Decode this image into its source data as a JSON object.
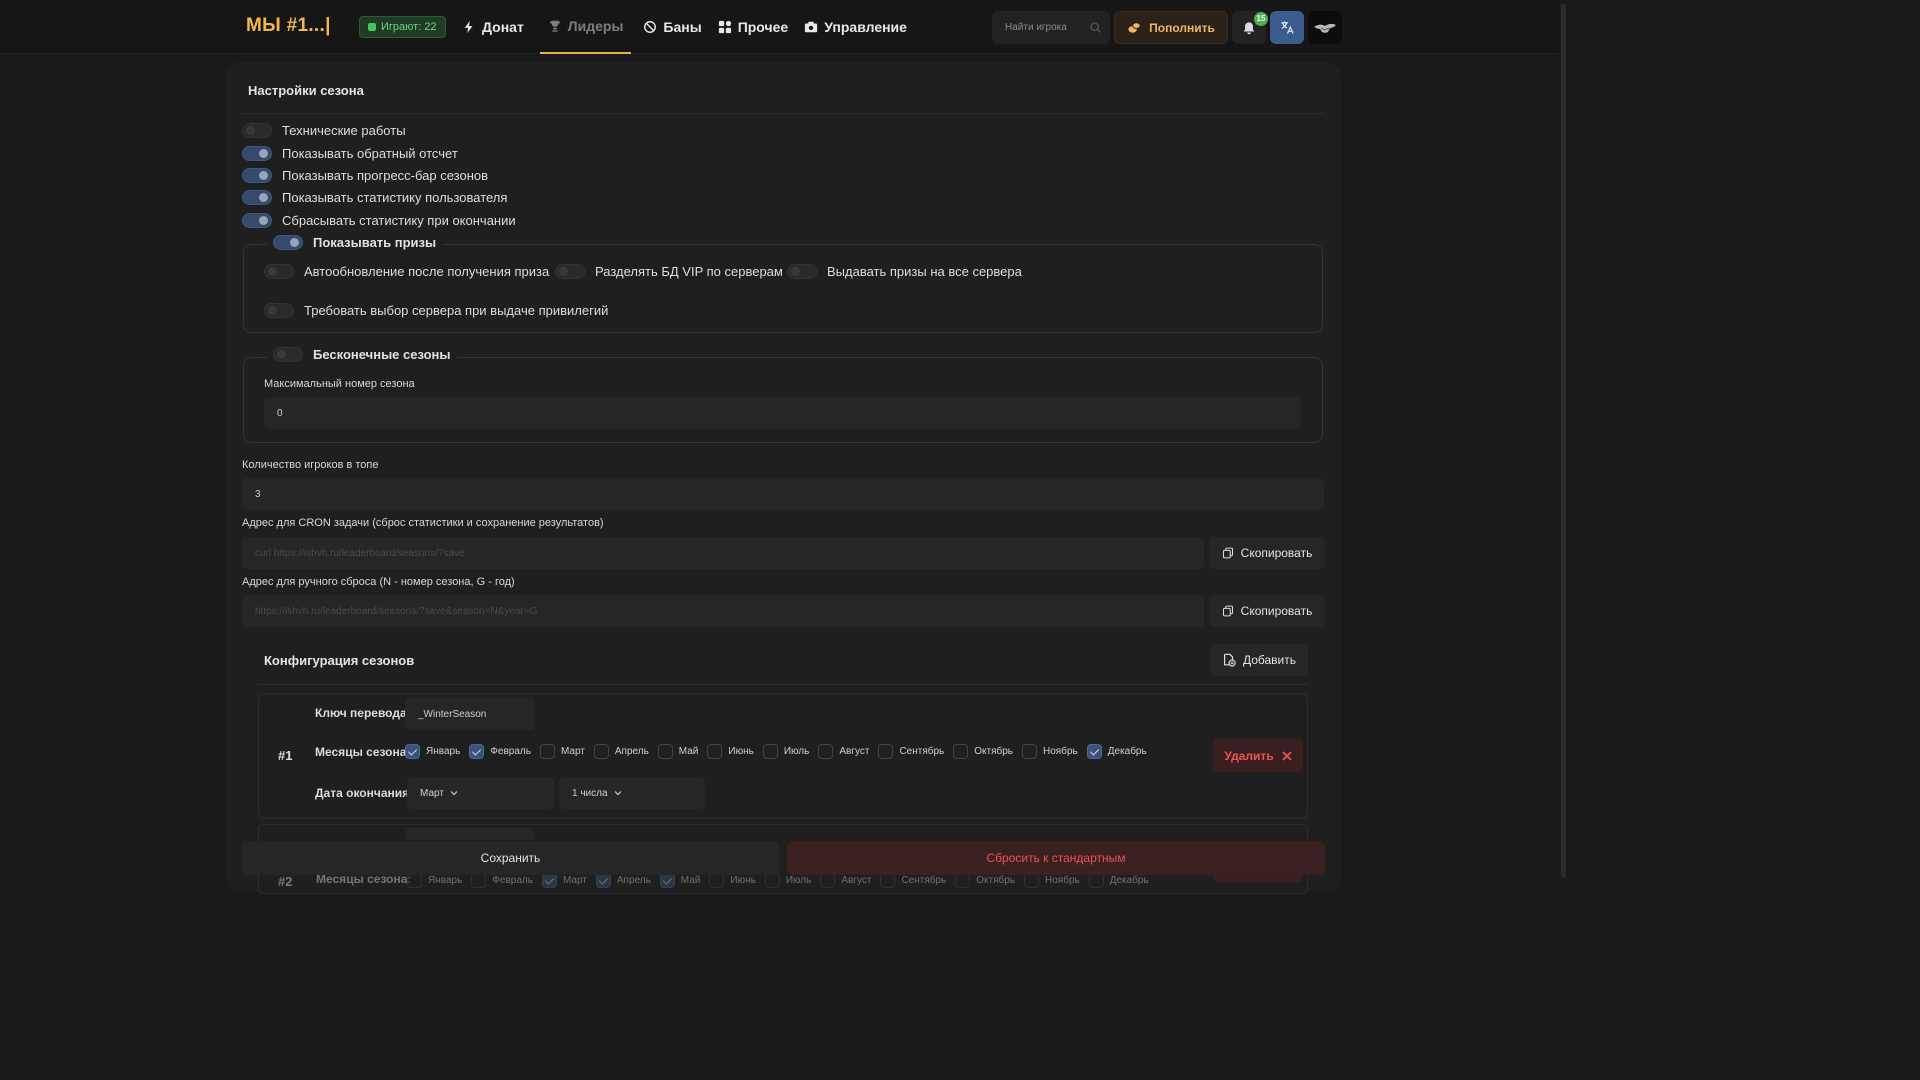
{
  "header": {
    "logo": "МЫ #1...|",
    "online": "Играют: 22",
    "nav": [
      {
        "label": "Донат",
        "icon": "bolt-icon",
        "active": false
      },
      {
        "label": "Лидеры",
        "icon": "trophy-icon",
        "active": true
      },
      {
        "label": "Баны",
        "icon": "ban-icon",
        "active": false
      },
      {
        "label": "Прочее",
        "icon": "grid-icon",
        "active": false
      },
      {
        "label": "Управление",
        "icon": "camera-icon",
        "active": false
      }
    ],
    "search_placeholder": "Найти игрока",
    "topup_label": "Пополнить",
    "notifications_count": "15"
  },
  "settings": {
    "title": "Настройки сезона",
    "toggles": [
      {
        "label": "Технические работы",
        "on": false
      },
      {
        "label": "Показывать обратный отсчет",
        "on": true
      },
      {
        "label": "Показывать прогресс-бар сезонов",
        "on": true
      },
      {
        "label": "Показывать статистику пользователя",
        "on": true
      },
      {
        "label": "Сбрасывать статистику при окончании",
        "on": true
      }
    ],
    "prizes": {
      "label": "Показывать призы",
      "on": true,
      "options": [
        {
          "label": "Автообновление после получения приза",
          "on": false
        },
        {
          "label": "Разделять БД VIP по серверам",
          "on": false
        },
        {
          "label": "Выдавать призы на все сервера",
          "on": false
        },
        {
          "label": "Требовать выбор сервера при выдаче привилегий",
          "on": false
        }
      ]
    },
    "infinite": {
      "label": "Бесконечные сезоны",
      "on": false,
      "max_label": "Максимальный номер сезона",
      "max_value": "0"
    },
    "top_label": "Количество игроков в топе",
    "top_value": "3",
    "cron_label": "Адрес для CRON задачи (сброс статистики и сохранение результатов)",
    "cron_value": "curl https://ishvh.ru/leaderboard/seasons/?save",
    "manual_label": "Адрес для ручного сброса (N - номер сезона, G - год)",
    "manual_value": "https://ishvh.ru/leaderboard/seasons/?save&season=N&year=G",
    "copy_label": "Скопировать"
  },
  "config": {
    "title": "Конфигурация сезонов",
    "add_label": "Добавить",
    "key_label": "Ключ перевода:",
    "months_label": "Месяцы сезона:",
    "end_label": "Дата окончания:",
    "delete_label": "Удалить",
    "seasons": [
      {
        "num": "#1",
        "key": "_WinterSeason",
        "months": [
          {
            "name": "Январь",
            "on": true
          },
          {
            "name": "Февраль",
            "on": true
          },
          {
            "name": "Март",
            "on": false
          },
          {
            "name": "Апрель",
            "on": false
          },
          {
            "name": "Май",
            "on": false
          },
          {
            "name": "Июнь",
            "on": false
          },
          {
            "name": "Июль",
            "on": false
          },
          {
            "name": "Август",
            "on": false
          },
          {
            "name": "Сентябрь",
            "on": false
          },
          {
            "name": "Октябрь",
            "on": false
          },
          {
            "name": "Ноябрь",
            "on": false
          },
          {
            "name": "Декабрь",
            "on": true
          }
        ],
        "end_month": "Март",
        "end_day": "1 числа"
      },
      {
        "num": "#2",
        "key": "",
        "months": [
          {
            "name": "Январь",
            "on": false
          },
          {
            "name": "Февраль",
            "on": false
          },
          {
            "name": "Март",
            "on": true
          },
          {
            "name": "Апрель",
            "on": true
          },
          {
            "name": "Май",
            "on": true
          },
          {
            "name": "Июнь",
            "on": false
          },
          {
            "name": "Июль",
            "on": false
          },
          {
            "name": "Август",
            "on": false
          },
          {
            "name": "Сентябрь",
            "on": false
          },
          {
            "name": "Октябрь",
            "on": false
          },
          {
            "name": "Ноябрь",
            "on": false
          },
          {
            "name": "Декабрь",
            "on": false
          }
        ]
      }
    ]
  },
  "footer": {
    "save_label": "Сохранить",
    "reset_label": "Сбросить к стандартным"
  },
  "colors": {
    "accent": "#e8b24a",
    "toggle_on": "#354b6e",
    "danger": "#ef5350",
    "online": "#4fc25f"
  }
}
